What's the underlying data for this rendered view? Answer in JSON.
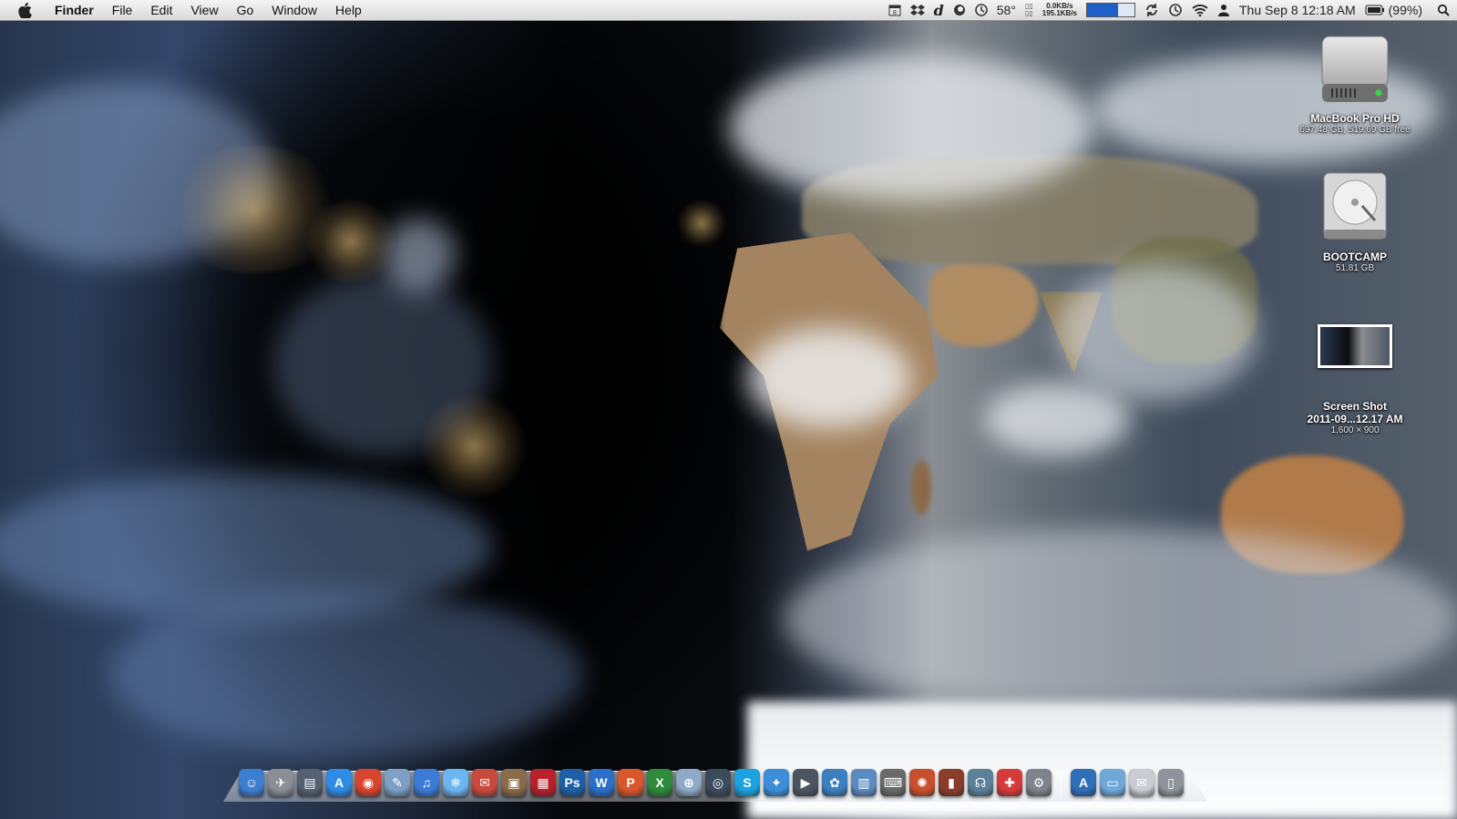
{
  "menubar": {
    "app_name": "Finder",
    "menus": [
      "File",
      "Edit",
      "View",
      "Go",
      "Window",
      "Help"
    ],
    "status": {
      "weather": "58°",
      "net_up": "0.0KB/s",
      "net_down": "195.1KB/s",
      "clock": "Thu Sep 8  12:18 AM",
      "battery": "(99%)"
    }
  },
  "desktop": {
    "items": [
      {
        "label": "MacBook Pro HD",
        "sub": "697.48 GB, 519.69 GB free",
        "icon": "hard-drive-icon"
      },
      {
        "label": "BOOTCAMP",
        "sub": "51.81 GB",
        "icon": "disk-drive-icon"
      },
      {
        "label": "Screen Shot",
        "label2": "2011-09...12.17 AM",
        "sub": "1,600 × 900",
        "icon": "screenshot-thumbnail-icon"
      }
    ]
  },
  "dock": {
    "apps": [
      {
        "name": "finder",
        "glyph": "☺",
        "color": "#3c7fd1"
      },
      {
        "name": "launchpad",
        "glyph": "✈",
        "color": "#8a8f96"
      },
      {
        "name": "dashboard",
        "glyph": "▤",
        "color": "#556070"
      },
      {
        "name": "app-store",
        "glyph": "A",
        "color": "#2f8ce6"
      },
      {
        "name": "chrome",
        "glyph": "◉",
        "color": "#d9442e"
      },
      {
        "name": "preview",
        "glyph": "✎",
        "color": "#7da0c6"
      },
      {
        "name": "itunes",
        "glyph": "♫",
        "color": "#3a7bd5"
      },
      {
        "name": "snowflake",
        "glyph": "❄",
        "color": "#6bb6f0"
      },
      {
        "name": "mail-stamp",
        "glyph": "✉",
        "color": "#c94a3c"
      },
      {
        "name": "iphoto",
        "glyph": "▣",
        "color": "#8a6b4a"
      },
      {
        "name": "photo-booth",
        "glyph": "▦",
        "color": "#b8202a"
      },
      {
        "name": "photoshop",
        "glyph": "Ps",
        "color": "#1d5fa6"
      },
      {
        "name": "word",
        "glyph": "W",
        "color": "#2a6fc9"
      },
      {
        "name": "powerpoint",
        "glyph": "P",
        "color": "#d9572b"
      },
      {
        "name": "excel",
        "glyph": "X",
        "color": "#2e8b3a"
      },
      {
        "name": "safari",
        "glyph": "⊕",
        "color": "#8fa9c7"
      },
      {
        "name": "time-machine",
        "glyph": "◎",
        "color": "#3b4a5c"
      },
      {
        "name": "skype",
        "glyph": "S",
        "color": "#1aa3e0"
      },
      {
        "name": "twitter",
        "glyph": "✦",
        "color": "#3d8ed9"
      },
      {
        "name": "facetime",
        "glyph": "▶",
        "color": "#4a5560"
      },
      {
        "name": "pinwheel",
        "glyph": "✿",
        "color": "#3b7fbf"
      },
      {
        "name": "textwrangler",
        "glyph": "▥",
        "color": "#5b8bc2"
      },
      {
        "name": "typewriter",
        "glyph": "⌨",
        "color": "#6a6a6a"
      },
      {
        "name": "color-sync",
        "glyph": "✺",
        "color": "#c94f2c"
      },
      {
        "name": "library",
        "glyph": "▮",
        "color": "#8b3d2a"
      },
      {
        "name": "owl",
        "glyph": "☊",
        "color": "#5c7f9a"
      },
      {
        "name": "crossover",
        "glyph": "✚",
        "color": "#d63a3a"
      },
      {
        "name": "system-preferences",
        "glyph": "⚙",
        "color": "#7d848c"
      }
    ],
    "stacks": [
      {
        "name": "applications-stack",
        "glyph": "A",
        "color": "#2e6fb8"
      },
      {
        "name": "documents-stack",
        "glyph": "▭",
        "color": "#6fa8d8"
      },
      {
        "name": "downloads-stack",
        "glyph": "✉",
        "color": "#c8cdd4"
      },
      {
        "name": "trash",
        "glyph": "▯",
        "color": "#8e949b"
      }
    ]
  }
}
